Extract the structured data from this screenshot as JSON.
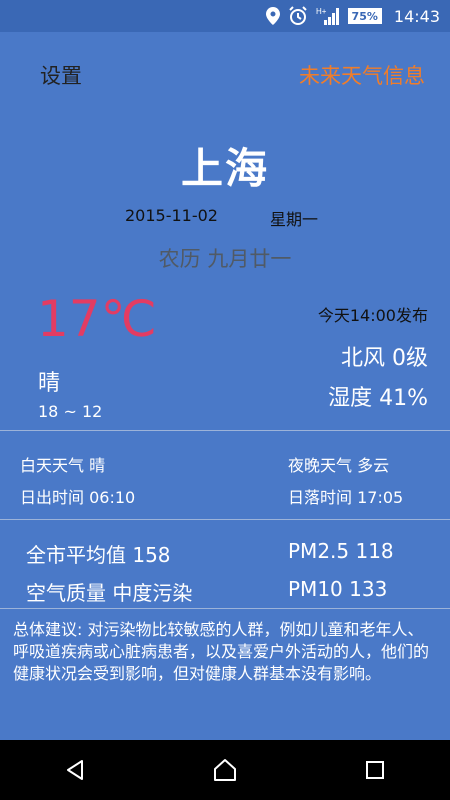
{
  "status_bar": {
    "network_label": "H+",
    "battery": "75%",
    "time": "14:43"
  },
  "topbar": {
    "settings_label": "设置",
    "future_label": "未来天气信息",
    "future_color": "#f07d2a"
  },
  "weather": {
    "city": "上海",
    "date": "2015-11-02",
    "weekday": "星期一",
    "lunar": "农历 九月廿一",
    "temperature": "17℃",
    "temperature_color": "#e33c63",
    "publish_time": "今天14:00发布",
    "wind": "北风  0级",
    "humidity": "湿度  41%",
    "condition": "晴",
    "temp_range": "18 ~ 12"
  },
  "day_night": {
    "day_weather": "白天天气  晴",
    "night_weather": "夜晚天气  多云",
    "sunrise": "日出时间  06:10",
    "sunset": "日落时间  17:05"
  },
  "air": {
    "city_avg": "全市平均值  158",
    "pm25": "PM2.5   118",
    "quality": "空气质量    中度污染",
    "pm10": "PM10    133"
  },
  "advice": "总体建议: 对污染物比较敏感的人群，例如儿童和老年人、呼吸道疾病或心脏病患者，以及喜爱户外活动的人，他们的健康状况会受到影响，但对健康人群基本没有影响。",
  "nav": {
    "icons": [
      "back-icon",
      "home-icon",
      "recents-icon"
    ]
  }
}
